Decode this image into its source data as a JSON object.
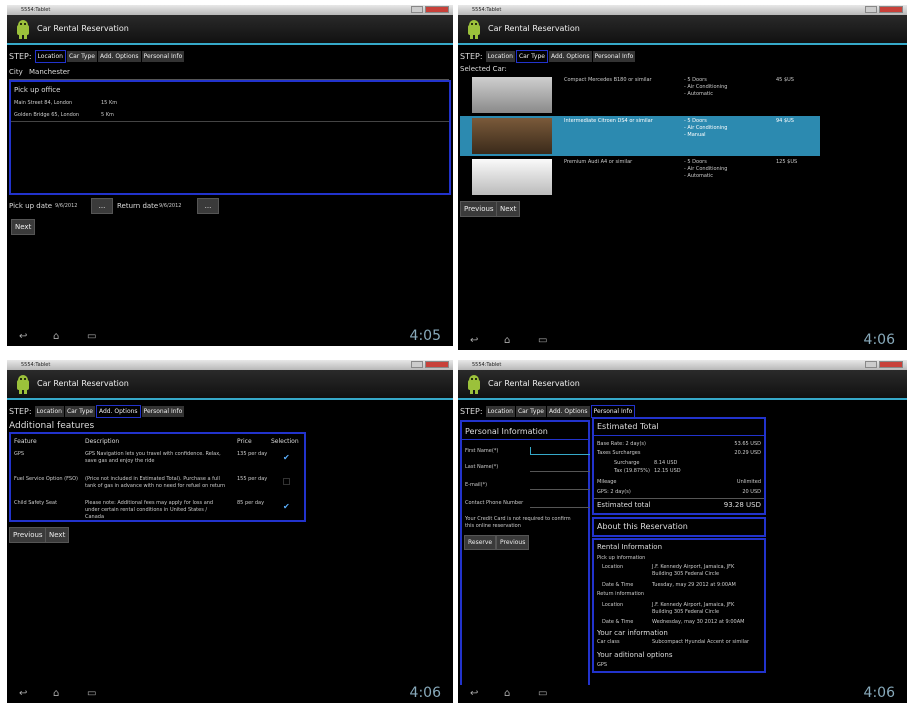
{
  "window_title": "5554:Tablet",
  "app_title": "Car Rental Reservation",
  "step_label": "STEP:",
  "steps": [
    "Location",
    "Car Type",
    "Add. Options",
    "Personal Info"
  ],
  "clock1": "4:05",
  "clock2": "4:06",
  "clock3": "4:06",
  "clock4": "4:06",
  "p1": {
    "city_label": "City",
    "city_value": "Manchester",
    "office_header": "Pick up office",
    "offices": [
      {
        "address": "Main Street 84, London",
        "dist": "15 Km"
      },
      {
        "address": "Golden Bridge 65, London",
        "dist": "5 Km"
      }
    ],
    "pickup_label": "Pick up date",
    "pickup_value": "9/6/2012",
    "return_label": "Return date",
    "return_value": "9/6/2012",
    "dots": "...",
    "next": "Next"
  },
  "p2": {
    "selected_label": "Selected Car:",
    "cars": [
      {
        "name": "Compact Mercedes B180 or similar",
        "f1": "- 5 Doors",
        "f2": "- Air Conditioning",
        "f3": "- Automatic",
        "price": "45 $US"
      },
      {
        "name": "Intermediate Citroen DS4 or similar",
        "f1": "- 5 Doors",
        "f2": "- Air Conditioning",
        "f3": "- Manual",
        "price": "94 $US"
      },
      {
        "name": "Premium Audi A4 or similar",
        "f1": "- 5 Doors",
        "f2": "- Air Conditioning",
        "f3": "- Automatic",
        "price": "125 $US"
      }
    ],
    "previous": "Previous",
    "next": "Next"
  },
  "p3": {
    "title": "Additional features",
    "headers": [
      "Feature",
      "Description",
      "Price",
      "Selection"
    ],
    "rows": [
      {
        "feature": "GPS",
        "desc1": "GPS Navigation lets you travel with confidence. Relax,",
        "desc2": "save gas and enjoy the ride",
        "desc3": "",
        "price": "135 per day",
        "checked": true
      },
      {
        "feature": "Fuel Service Option (FSO)",
        "desc1": "(Price not included in Estimated Total). Purchase a full",
        "desc2": "tank of gas in advance with no need for refuel on return",
        "desc3": "",
        "price": "155 per day",
        "checked": false
      },
      {
        "feature": "Child Safety Seat",
        "desc1": "Please note: Additional fees may apply for loss and",
        "desc2": "under certain rental conditions in United States /",
        "desc3": "Canada",
        "price": "85 per day",
        "checked": true
      }
    ],
    "previous": "Previous",
    "next": "Next"
  },
  "p4": {
    "personal_title": "Personal Information",
    "first_name": "First Name(*)",
    "last_name": "Last Name(*)",
    "email": "E-mail(*)",
    "phone": "Contact Phone Number",
    "note1": "Your Credit Card is not required to confirm",
    "note2": "this online reservation",
    "reserve": "Reserve",
    "previous": "Previous",
    "est_title": "Estimated Total",
    "base_rate_label": "Base Rate: 2 day(s)",
    "base_rate_value": "53.65 USD",
    "taxes_label": "Taxes  Surcharges",
    "taxes_value": "20.29 USD",
    "surcharge_label": "Surcharge",
    "surcharge_value": "8.14 USD",
    "tax_label": "Tax (19.875%)",
    "tax_value": "12.15 USD",
    "mileage_label": "Mileage",
    "mileage_value": "Unlimited",
    "gps_label": "GPS: 2 day(s)",
    "gps_value": "20 USD",
    "est_total_label": "Estimated total",
    "est_total_value": "93.28 USD",
    "about_title": "About this Reservation",
    "rental_info": "Rental Information",
    "pickup_info": "Pick up information",
    "location_label": "Location",
    "pickup_loc1": "J.F. Kennedy Airport, Jamaica, JFK",
    "pickup_loc2": "Building 305 Federal Circle",
    "datetime_label": "Date & Time",
    "pickup_time": "Tuesday, may 29 2012 at 9:00AM",
    "return_info": "Return information",
    "return_loc1": "J.F. Kennedy Airport, Jamaica, JFK",
    "return_loc2": "Building 305 Federal Circle",
    "return_time": "Wednesday, may 30 2012 at 9:00AM",
    "your_car": "Your car information",
    "car_class_label": "Car class",
    "car_class_value": "Subcompact Hyundai Accent or similar",
    "your_options": "Your aditional options",
    "option_gps": "GPS"
  }
}
